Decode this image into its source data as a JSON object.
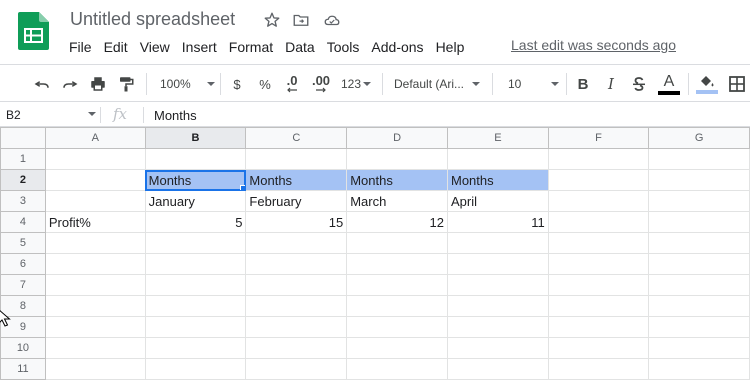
{
  "app": {
    "doc_title": "Untitled spreadsheet",
    "last_edit": "Last edit was seconds ago"
  },
  "menu": [
    "File",
    "Edit",
    "View",
    "Insert",
    "Format",
    "Data",
    "Tools",
    "Add-ons",
    "Help"
  ],
  "toolbar": {
    "zoom": "100%",
    "currency": "$",
    "percent": "%",
    "decrease_decimals": ".0",
    "increase_decimals": ".00",
    "more_formats": "123",
    "font": "Default (Ari...",
    "font_size": "10",
    "bold": "B",
    "italic": "I",
    "text_color_letter": "A",
    "text_color": "#000000",
    "fill_color": "#a4c2f4"
  },
  "formula_bar": {
    "name_box": "B2",
    "fx_label": "fx",
    "value": "Months"
  },
  "grid": {
    "columns": [
      "A",
      "B",
      "C",
      "D",
      "E",
      "F",
      "G"
    ],
    "active_cell": "B2",
    "rows": [
      {
        "num": "1",
        "cells": [
          "",
          "",
          "",
          "",
          "",
          "",
          ""
        ]
      },
      {
        "num": "2",
        "cells": [
          "",
          "Months",
          "Months",
          "Months",
          "Months",
          "",
          ""
        ]
      },
      {
        "num": "3",
        "cells": [
          "",
          "January",
          "February",
          "March",
          "April",
          "",
          ""
        ]
      },
      {
        "num": "4",
        "cells": [
          "Profit%",
          "5",
          "15",
          "12",
          "11",
          "",
          ""
        ]
      },
      {
        "num": "5",
        "cells": [
          "",
          "",
          "",
          "",
          "",
          "",
          ""
        ]
      },
      {
        "num": "6",
        "cells": [
          "",
          "",
          "",
          "",
          "",
          "",
          ""
        ]
      },
      {
        "num": "7",
        "cells": [
          "",
          "",
          "",
          "",
          "",
          "",
          ""
        ]
      },
      {
        "num": "8",
        "cells": [
          "",
          "",
          "",
          "",
          "",
          "",
          ""
        ]
      },
      {
        "num": "9",
        "cells": [
          "",
          "",
          "",
          "",
          "",
          "",
          ""
        ]
      },
      {
        "num": "10",
        "cells": [
          "",
          "",
          "",
          "",
          "",
          "",
          ""
        ]
      },
      {
        "num": "11",
        "cells": [
          "",
          "",
          "",
          "",
          "",
          "",
          ""
        ]
      }
    ]
  },
  "colors": {
    "header_highlight": "#a4c2f4",
    "selection": "#1a73e8",
    "brand_green": "#0f9d58"
  }
}
